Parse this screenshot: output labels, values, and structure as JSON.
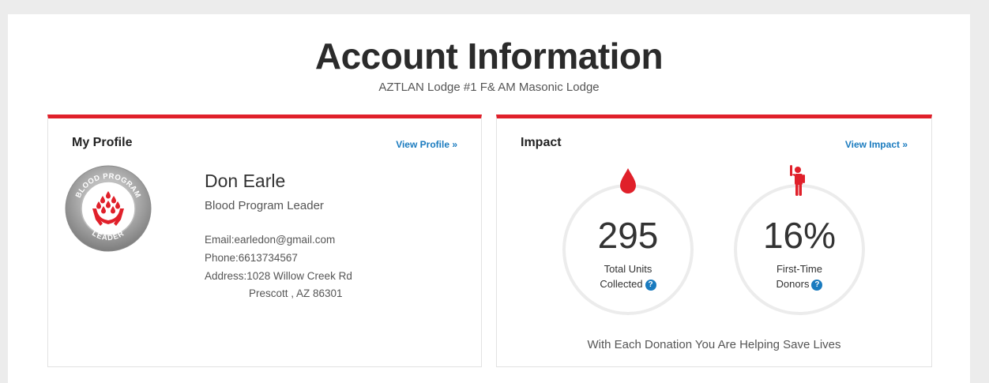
{
  "header": {
    "title": "Account Information",
    "subtitle": "AZTLAN Lodge #1 F& AM Masonic Lodge"
  },
  "profile": {
    "card_title": "My Profile",
    "link_label": "View Profile »",
    "badge_top_text": "BLOOD PROGRAM",
    "badge_bottom_text": "LEADER",
    "name": "Don Earle",
    "role": "Blood Program Leader",
    "email": "Email:earledon@gmail.com",
    "phone": "Phone:6613734567",
    "address_line1": "Address:1028 Willow Creek Rd",
    "address_line2": "Prescott , AZ 86301"
  },
  "impact": {
    "card_title": "Impact",
    "link_label": "View Impact »",
    "stats": [
      {
        "value": "295",
        "label_line1": "Total Units",
        "label_line2": "Collected",
        "icon": "blood-drop-icon"
      },
      {
        "value": "16%",
        "label_line1": "First-Time",
        "label_line2": "Donors",
        "icon": "person-raising-hand-icon"
      }
    ],
    "help_glyph": "?",
    "tagline": "With Each Donation You Are Helping Save Lives"
  },
  "colors": {
    "accent_red": "#e0202a",
    "link_blue": "#1a7bbf",
    "background": "#ececec"
  }
}
